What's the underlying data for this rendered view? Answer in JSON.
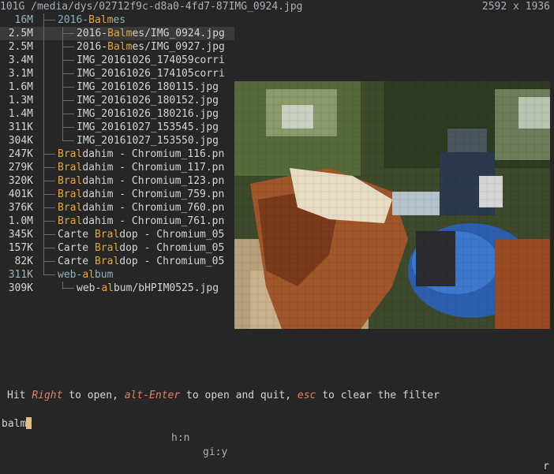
{
  "header": {
    "path": "101G /media/dys/02712f9c-d8a0-4fd7-87IMG_0924.jpg",
    "dimensions": "2592 x 1936"
  },
  "rows": [
    {
      "size": "16M",
      "pre": "2016-",
      "hl": "Balm",
      "post": "es",
      "dir": true
    },
    {
      "size": "2.5M",
      "pre": "2016-",
      "hl": "Balm",
      "post": "es/IMG_0924.jpg",
      "dir": false,
      "selected": true
    },
    {
      "size": "2.5M",
      "pre": "2016-",
      "hl": "Balm",
      "post": "es/IMG_0927.jpg",
      "dir": false
    },
    {
      "size": "3.4M",
      "pre": "IMG_20161026_174059corri",
      "hl": "",
      "post": "",
      "dir": false
    },
    {
      "size": "3.1M",
      "pre": "IMG_20161026_174105corri",
      "hl": "",
      "post": "",
      "dir": false
    },
    {
      "size": "1.6M",
      "pre": "IMG_20161026_180115.jpg",
      "hl": "",
      "post": "",
      "dir": false
    },
    {
      "size": "1.3M",
      "pre": "IMG_20161026_180152.jpg",
      "hl": "",
      "post": "",
      "dir": false
    },
    {
      "size": "1.4M",
      "pre": "IMG_20161026_180216.jpg",
      "hl": "",
      "post": "",
      "dir": false
    },
    {
      "size": "311K",
      "pre": "IMG_20161027_153545.jpg",
      "hl": "",
      "post": "",
      "dir": false
    },
    {
      "size": "304K",
      "pre": "IMG_20161027_153550.jpg",
      "hl": "",
      "post": "",
      "dir": false
    },
    {
      "size": "247K",
      "pre": "",
      "hl": "Bral",
      "post": "dahim - Chromium_116.pn",
      "dir": false
    },
    {
      "size": "279K",
      "pre": "",
      "hl": "Bral",
      "post": "dahim - Chromium_117.pn",
      "dir": false
    },
    {
      "size": "320K",
      "pre": "",
      "hl": "Bral",
      "post": "dahim - Chromium_123.pn",
      "dir": false
    },
    {
      "size": "401K",
      "pre": "",
      "hl": "Bral",
      "post": "dahim - Chromium_759.pn",
      "dir": false
    },
    {
      "size": "376K",
      "pre": "",
      "hl": "Bral",
      "post": "dahim - Chromium_760.pn",
      "dir": false
    },
    {
      "size": "1.0M",
      "pre": "",
      "hl": "Bral",
      "post": "dahim - Chromium_761.pn",
      "dir": false
    },
    {
      "size": "345K",
      "pre": "Carte ",
      "hl": "Bral",
      "post": "dop - Chromium_05",
      "dir": false
    },
    {
      "size": "157K",
      "pre": "Carte ",
      "hl": "Bral",
      "post": "dop - Chromium_05",
      "dir": false
    },
    {
      "size": "82K",
      "pre": "Carte ",
      "hl": "Bral",
      "post": "dop - Chromium_05",
      "dir": false
    },
    {
      "size": "311K",
      "pre": "web-",
      "hl": "al",
      "post": "bum",
      "dir": true
    },
    {
      "size": "309K",
      "pre": "web-",
      "hl": "al",
      "post": "bum/bHPIM0525.jpg",
      "dir": false
    }
  ],
  "footer": {
    "hit": "Hit ",
    "right": "Right",
    "to_open": " to open, ",
    "alt_enter": "alt-Enter",
    "to_open_quit": " to open and quit, ",
    "esc": "esc",
    "to_clear": " to clear the filter"
  },
  "status": {
    "input": "balm",
    "hn": "h:n",
    "gi": "gi:y",
    "right": "r"
  },
  "preview": {
    "description_icon": "image-preview"
  }
}
